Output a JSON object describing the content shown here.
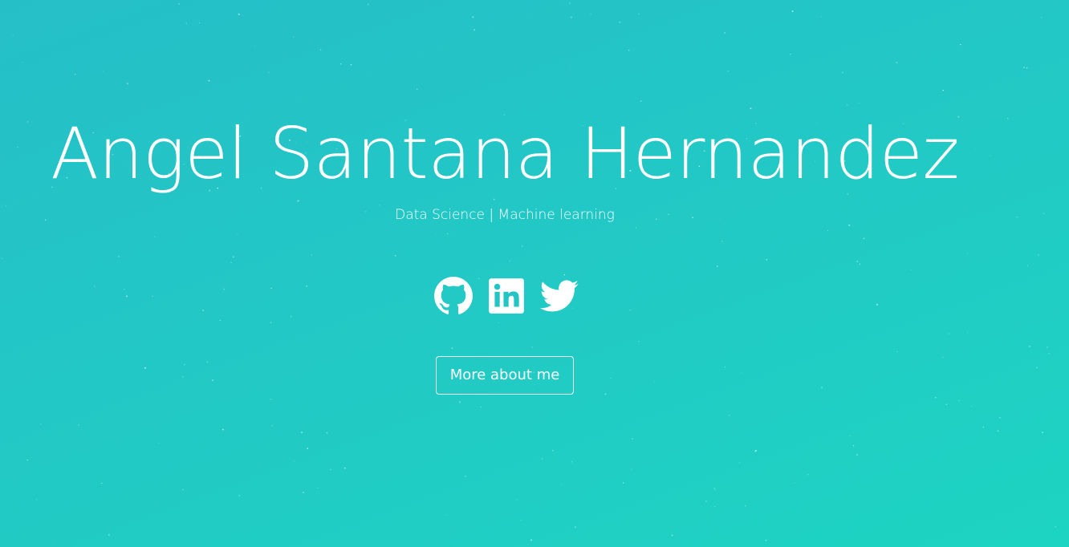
{
  "hero": {
    "name": "Angel Santana Hernandez",
    "subtitle": "Data Science | Machine learning"
  },
  "social": [
    {
      "icon": "github-icon",
      "label": "GitHub"
    },
    {
      "icon": "linkedin-icon",
      "label": "LinkedIn"
    },
    {
      "icon": "twitter-icon",
      "label": "Twitter"
    }
  ],
  "cta": {
    "label": "More about me"
  },
  "colors": {
    "background_start": "#25bfc8",
    "background_end": "#1dd4c2",
    "text": "#ffffff"
  }
}
